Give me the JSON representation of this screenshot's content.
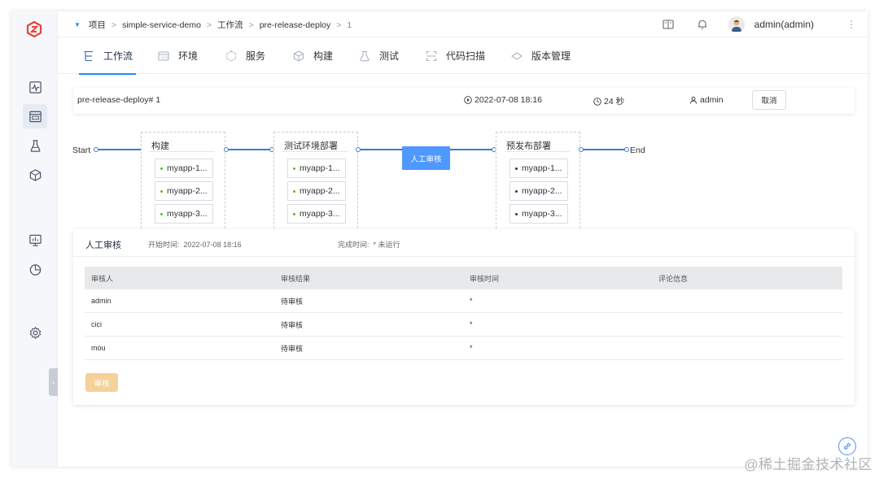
{
  "breadcrumb": {
    "items": [
      "项目",
      "simple-service-demo",
      "工作流",
      "pre-release-deploy",
      "1"
    ]
  },
  "header": {
    "user": "admin(admin)"
  },
  "tabs": [
    {
      "label": "工作流",
      "icon": "workflow-icon",
      "active": true
    },
    {
      "label": "环境",
      "icon": "environment-icon"
    },
    {
      "label": "服务",
      "icon": "service-icon"
    },
    {
      "label": "构建",
      "icon": "build-icon"
    },
    {
      "label": "测试",
      "icon": "test-icon"
    },
    {
      "label": "代码扫描",
      "icon": "code-scan-icon"
    },
    {
      "label": "版本管理",
      "icon": "version-icon"
    }
  ],
  "task": {
    "name": "pre-release-deploy# 1",
    "start_time": "2022-07-08 18:16",
    "duration": "24 秒",
    "creator": "admin",
    "cancel_label": "取消"
  },
  "flow": {
    "start_label": "Start",
    "end_label": "End",
    "approval_label": "人工审核",
    "stages": [
      {
        "title": "构建",
        "jobs": [
          "myapp-1...",
          "myapp-2...",
          "myapp-3..."
        ],
        "job_status_color": "#52c41a"
      },
      {
        "title": "测试环境部署",
        "jobs": [
          "myapp-1...",
          "myapp-2...",
          "myapp-3..."
        ],
        "job_status_color": "#52c41a"
      },
      {
        "title": "预发布部署",
        "jobs": [
          "myapp-1...",
          "myapp-2...",
          "myapp-3..."
        ],
        "job_status_color": "#333333"
      }
    ]
  },
  "approval": {
    "title": "人工审核",
    "start_label": "开始时间:",
    "start_value": "2022-07-08 18:16",
    "end_label": "完成时间:",
    "end_value": "* 未运行",
    "columns": [
      "审核人",
      "审核结果",
      "审核时间",
      "评论信息"
    ],
    "rows": [
      [
        "admin",
        "待审核",
        "*",
        ""
      ],
      [
        "cici",
        "待审核",
        "*",
        ""
      ],
      [
        "mou",
        "待审核",
        "*",
        ""
      ]
    ],
    "approve_label": "审核"
  },
  "colors": {
    "accent": "#1890ff",
    "approval_node": "#4e98ff",
    "approve_button": "#f4d29a"
  },
  "watermark": "@稀土掘金技术社区"
}
